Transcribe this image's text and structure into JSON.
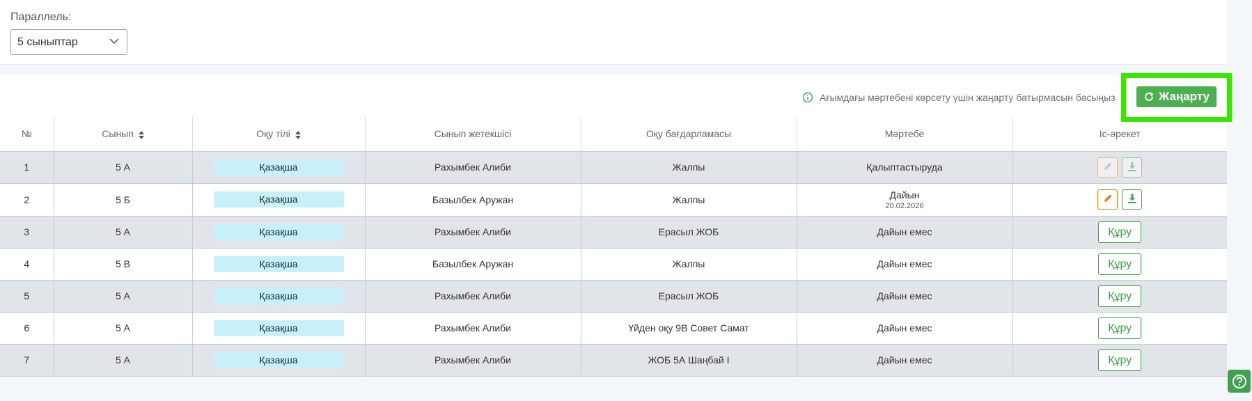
{
  "filter": {
    "label": "Параллель:",
    "selected": "5 сыныптар"
  },
  "info": {
    "text": "Ағымдағы мәртебені көрсету үшін жаңарту батырмасын басыңыз",
    "refresh_label": "Жаңарту"
  },
  "table": {
    "headers": {
      "num": "№",
      "class": "Сынып",
      "lang": "Оқу тілі",
      "teacher": "Сынып жетекшісі",
      "program": "Оқу бағдарламасы",
      "status": "Мәртебе",
      "action": "Іс-әрекет"
    },
    "rows": [
      {
        "num": "1",
        "class": "5 А",
        "lang": "Қазақша",
        "teacher": "Рахымбек Алиби",
        "program": "Жалпы",
        "status": "Қалыптастыруда",
        "date": "",
        "action": "icons-disabled"
      },
      {
        "num": "2",
        "class": "5 Б",
        "lang": "Қазақша",
        "teacher": "Базылбек Аружан",
        "program": "Жалпы",
        "status": "Дайын",
        "date": "20.02.2026",
        "action": "icons-active"
      },
      {
        "num": "3",
        "class": "5 А",
        "lang": "Қазақша",
        "teacher": "Рахымбек Алиби",
        "program": "Ерасыл ЖОБ",
        "status": "Дайын емес",
        "date": "",
        "action": "create"
      },
      {
        "num": "4",
        "class": "5 В",
        "lang": "Қазақша",
        "teacher": "Базылбек Аружан",
        "program": "Жалпы",
        "status": "Дайын емес",
        "date": "",
        "action": "create"
      },
      {
        "num": "5",
        "class": "5 А",
        "lang": "Қазақша",
        "teacher": "Рахымбек Алиби",
        "program": "Ерасыл ЖОБ",
        "status": "Дайын емес",
        "date": "",
        "action": "create"
      },
      {
        "num": "6",
        "class": "5 А",
        "lang": "Қазақша",
        "teacher": "Рахымбек Алиби",
        "program": "Үйден оқу 9В Совет Самат",
        "status": "Дайын емес",
        "date": "",
        "action": "create"
      },
      {
        "num": "7",
        "class": "5 А",
        "lang": "Қазақша",
        "teacher": "Рахымбек Алиби",
        "program": "ЖОБ 5А Шаңбай І",
        "status": "Дайын емес",
        "date": "",
        "action": "create"
      }
    ],
    "create_label": "Құру"
  },
  "icons": {
    "chevron": "chevron-down-icon",
    "info": "info-icon",
    "refresh": "refresh-icon",
    "sort": "sort-icon",
    "edit": "pencil-icon",
    "download": "download-icon",
    "help": "question-icon"
  },
  "colors": {
    "accent_green": "#4caf50",
    "highlight": "#39e600",
    "edit_orange": "#f07d16",
    "lang_pill": "#c6f1fb",
    "row_stripe": "#e1e5ea"
  }
}
